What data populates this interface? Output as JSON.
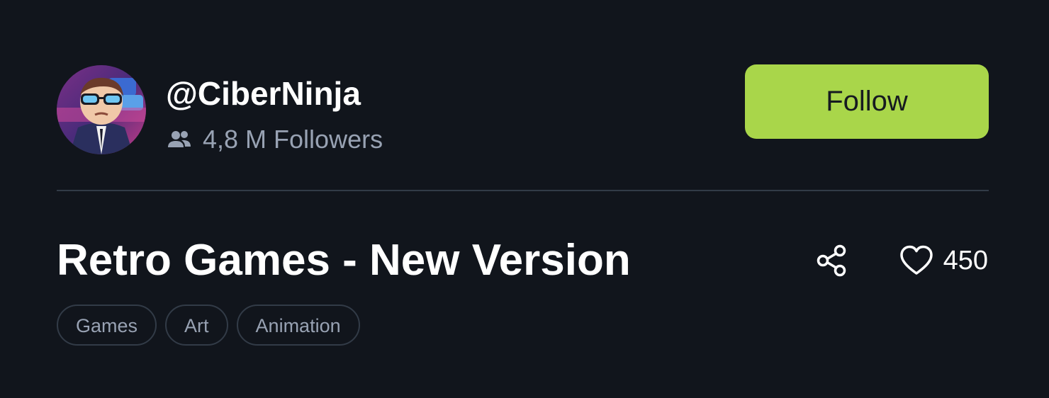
{
  "profile": {
    "username": "@CiberNinja",
    "followers_icon": "users-icon",
    "followers_text": "4,8 M Followers",
    "follow_label": "Follow"
  },
  "post": {
    "title": "Retro Games - New Version",
    "share_icon": "share-icon",
    "like_icon": "heart-icon",
    "like_count": "450",
    "tags": [
      "Games",
      "Art",
      "Animation"
    ]
  },
  "colors": {
    "background": "#11151c",
    "accent": "#a9d64a",
    "muted_text": "#98a2b3",
    "border": "#323b47"
  }
}
